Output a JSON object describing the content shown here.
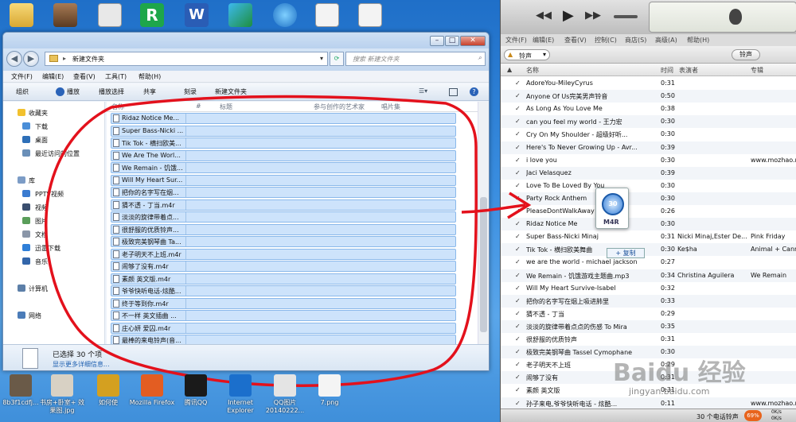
{
  "explorer": {
    "address": "新建文件夹",
    "search_placeholder": "搜索 新建文件夹",
    "menu": [
      "文件(F)",
      "编辑(E)",
      "查看(V)",
      "工具(T)",
      "帮助(H)"
    ],
    "toolbar": [
      "组织",
      "播放",
      "播放选择",
      "共享",
      "刻录",
      "新建文件夹"
    ],
    "nav": {
      "favorites": "收藏夹",
      "downloads": "下载",
      "desktop": "桌面",
      "recent": "最近访问的位置",
      "library": "库",
      "pptv": "PPTV视频",
      "video": "视频",
      "pictures": "图片",
      "docs": "文档",
      "thunder": "迅雷下载",
      "music": "音乐",
      "computer": "计算机",
      "network": "网络"
    },
    "columns": [
      "名称",
      "#",
      "标题",
      "参与创作的艺术家",
      "唱片集"
    ],
    "files": [
      "Ridaz Notice Me...",
      "Super Bass-Nicki ...",
      "Tik Tok - 横扫欧美...",
      "We Are The Worl...",
      "We Remain - 饥饿...",
      "Will My Heart Sur...",
      "把你的名字写在烟...",
      "猜不透 - 丁当.m4r",
      "淡淡的旋律带着点...",
      "很舒服的优质铃声...",
      "极致完美钢琴曲 Ta...",
      "老子明天不上班.m4r",
      "闹够了没有.m4r",
      "素颜 英文版.m4r",
      "爷爷快听电话-炫酷...",
      "终于等到你.m4r",
      "不一样 英文插曲 ...",
      "庄心妍 爱囚.m4r",
      "最棒的来电铃声(音..."
    ],
    "status_main": "已选择 30 个项",
    "status_link": "显示更多详细信息..."
  },
  "itunes": {
    "menu": [
      "文件(F)",
      "编辑(E)",
      "查看(V)",
      "控制(C)",
      "商店(S)",
      "高级(A)",
      "帮助(H)"
    ],
    "source": "铃声",
    "source_button": "铃声",
    "columns": [
      "名称",
      "时间",
      "表演者",
      "专辑"
    ],
    "tracks": [
      {
        "name": "AdoreYou-MileyCyrus",
        "time": "0:31",
        "artist": "",
        "album": ""
      },
      {
        "name": "Anyone Of Us完美男声铃音",
        "time": "0:50",
        "artist": "",
        "album": ""
      },
      {
        "name": "As Long As You Love Me",
        "time": "0:38",
        "artist": "",
        "album": ""
      },
      {
        "name": "can you feel my world - 王力宏",
        "time": "0:30",
        "artist": "",
        "album": ""
      },
      {
        "name": "Cry On My Shoulder - 超级好听...",
        "time": "0:30",
        "artist": "",
        "album": ""
      },
      {
        "name": "Here's To Never Growing Up - Avr...",
        "time": "0:39",
        "artist": "",
        "album": ""
      },
      {
        "name": "i love you",
        "time": "0:30",
        "artist": "",
        "album": "www.mozhao.net"
      },
      {
        "name": "Jaci Velasquez",
        "time": "0:39",
        "artist": "",
        "album": ""
      },
      {
        "name": "Love To Be Loved By You",
        "time": "0:30",
        "artist": "",
        "album": ""
      },
      {
        "name": "Party Rock Anthem",
        "time": "0:30",
        "artist": "",
        "album": ""
      },
      {
        "name": "PleaseDontWalkAway",
        "time": "0:26",
        "artist": "",
        "album": ""
      },
      {
        "name": "Ridaz Notice Me",
        "time": "0:30",
        "artist": "",
        "album": ""
      },
      {
        "name": "Super Bass-Nicki Minaj",
        "time": "0:31",
        "artist": "Nicki Minaj,Ester De...",
        "album": "Pink Friday"
      },
      {
        "name": "Tik Tok - 横扫欧美舞曲",
        "time": "0:30",
        "artist": "Ke$ha",
        "album": "Animal + Cann"
      },
      {
        "name": "we are the world - michael jackson",
        "time": "0:27",
        "artist": "",
        "album": ""
      },
      {
        "name": "We Remain - 饥饿游戏主题曲.mp3",
        "time": "0:34",
        "artist": "Christina Aguilera",
        "album": "We Remain"
      },
      {
        "name": "Will My Heart Survive-Isabel",
        "time": "0:32",
        "artist": "",
        "album": ""
      },
      {
        "name": "把你的名字写在烟上吸进肺里",
        "time": "0:33",
        "artist": "",
        "album": ""
      },
      {
        "name": "猜不透 - 丁当",
        "time": "0:29",
        "artist": "",
        "album": ""
      },
      {
        "name": "淡淡的旋律带着点点的伤感 To Mira",
        "time": "0:35",
        "artist": "",
        "album": ""
      },
      {
        "name": "很舒服的优质铃声",
        "time": "0:31",
        "artist": "",
        "album": ""
      },
      {
        "name": "极致完美钢琴曲 Tassel Cymophane",
        "time": "0:30",
        "artist": "",
        "album": ""
      },
      {
        "name": "老子明天不上班",
        "time": "0:29",
        "artist": "",
        "album": ""
      },
      {
        "name": "闹够了没有",
        "time": "0:31",
        "artist": "",
        "album": ""
      },
      {
        "name": "素颜 英文版",
        "time": "0:31",
        "artist": "",
        "album": ""
      },
      {
        "name": "孙子来电,爷爷快听电话 - 炫酷...",
        "time": "0:11",
        "artist": "",
        "album": "www.mozhao.net"
      }
    ],
    "footer": "30 个电话铃声",
    "footer_pct": "69%",
    "footer_rate1": "0K/s",
    "footer_rate2": "0K/s",
    "drag_label": "M4R",
    "drag_badge": "30",
    "copy_label": "+ 复制"
  },
  "desktop": {
    "icons": [
      "8b3f1cdfj...",
      "书房+卧室+ 效果图.jpg",
      "如何使",
      "Mozilla Firefox",
      "腾讯QQ",
      "Internet Explorer",
      "QQ图片 20140222...",
      "7.png"
    ]
  },
  "watermark": {
    "brand": "Baidu 经验",
    "url": "jingyan.baidu.com"
  },
  "colors": {
    "annotation_red": "#e3111c",
    "selection": "#cde3fb",
    "desktop_blue": "#3a8ee0"
  }
}
